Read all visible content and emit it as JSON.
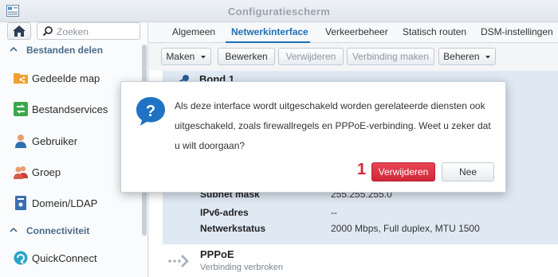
{
  "window": {
    "title": "Configuratiescherm"
  },
  "sidebar": {
    "search_placeholder": "Zoeken",
    "sections": [
      {
        "label": "Bestanden delen",
        "items": [
          {
            "label": "Gedeelde map",
            "icon": "shared-folder-icon"
          },
          {
            "label": "Bestandservices",
            "icon": "file-services-icon"
          },
          {
            "label": "Gebruiker",
            "icon": "user-icon"
          },
          {
            "label": "Groep",
            "icon": "group-icon"
          },
          {
            "label": "Domein/LDAP",
            "icon": "domain-ldap-icon"
          }
        ]
      },
      {
        "label": "Connectiviteit",
        "items": [
          {
            "label": "QuickConnect",
            "icon": "quickconnect-icon"
          }
        ]
      }
    ]
  },
  "tabs": [
    {
      "label": "Algemeen",
      "active": false
    },
    {
      "label": "Netwerkinterface",
      "active": true
    },
    {
      "label": "Verkeerbeheer",
      "active": false
    },
    {
      "label": "Statisch routen",
      "active": false
    },
    {
      "label": "DSM-instellingen",
      "active": false
    }
  ],
  "toolbar": {
    "make": "Maken",
    "edit": "Bewerken",
    "delete": "Verwijderen",
    "connect": "Verbinding maken",
    "manage": "Beheren"
  },
  "interfaces": {
    "bond": {
      "name": "Bond 1",
      "rows": [
        {
          "key": "Subnet mask",
          "value": "255.255.255.0"
        },
        {
          "key": "IPv6-adres",
          "value": "--"
        },
        {
          "key": "Netwerkstatus",
          "value": "2000 Mbps, Full duplex, MTU 1500"
        }
      ]
    },
    "pppoe": {
      "name": "PPPoE",
      "status": "Verbinding verbroken"
    }
  },
  "dialog": {
    "message": "Als deze interface wordt uitgeschakeld worden gerelateerde diensten ook uitgeschakeld, zoals firewallregels en PPPoE-verbinding. Weet u zeker dat u wilt doorgaan?",
    "marker": "1",
    "confirm": "Verwijderen",
    "cancel": "Nee"
  },
  "colors": {
    "accent": "#1f6fb5",
    "danger": "#d6263a",
    "selected_row": "#dfe9f4"
  }
}
